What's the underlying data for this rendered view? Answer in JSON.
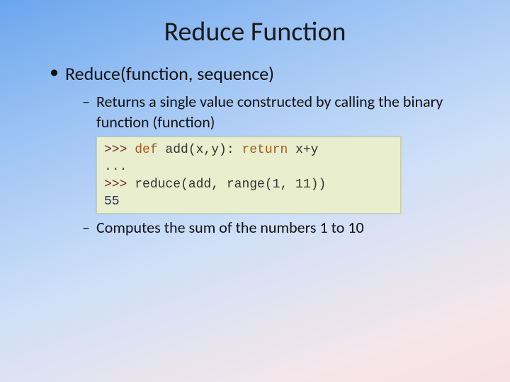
{
  "title": "Reduce Function",
  "bullet1": "Reduce(function, sequence)",
  "sub1": "Returns a single value constructed by calling the binary function (function)",
  "sub2": "Computes the sum of the numbers 1 to 10",
  "code": {
    "p1": ">>> ",
    "kw_def": "def",
    "def_rest": " add(x,y): ",
    "kw_return": "return",
    "ret_rest": " x+y",
    "cont": "...",
    "p2": ">>> ",
    "call": "reduce(add, range(1, 11))",
    "result": "55"
  }
}
